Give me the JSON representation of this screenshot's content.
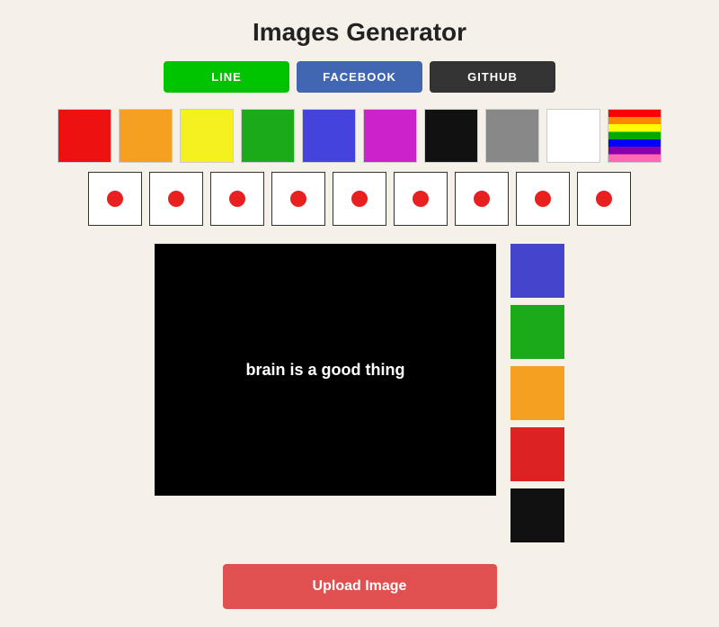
{
  "page": {
    "title": "Images Generator"
  },
  "platform_buttons": [
    {
      "id": "line",
      "label": "LINE",
      "class": "btn-line"
    },
    {
      "id": "facebook",
      "label": "FACEBOOK",
      "class": "btn-facebook"
    },
    {
      "id": "github",
      "label": "GITHUB",
      "class": "btn-github"
    }
  ],
  "color_swatches": [
    {
      "id": "red",
      "color": "#ee1111"
    },
    {
      "id": "orange",
      "color": "#f5a020"
    },
    {
      "id": "yellow",
      "color": "#f5f020"
    },
    {
      "id": "green",
      "color": "#1aaa1a"
    },
    {
      "id": "blue",
      "color": "#4444dd"
    },
    {
      "id": "magenta",
      "color": "#cc22cc"
    },
    {
      "id": "black",
      "color": "#111111"
    },
    {
      "id": "gray",
      "color": "#888888"
    },
    {
      "id": "white",
      "color": "#ffffff"
    },
    {
      "id": "rainbow",
      "color": "rainbow"
    }
  ],
  "dot_swatches_count": 9,
  "canvas": {
    "text": "brain is a good thing",
    "bg_color": "#000000"
  },
  "side_colors": [
    {
      "id": "blue2",
      "color": "#4444cc"
    },
    {
      "id": "green2",
      "color": "#1aaa1a"
    },
    {
      "id": "orange2",
      "color": "#f5a020"
    },
    {
      "id": "red2",
      "color": "#dd2222"
    },
    {
      "id": "black2",
      "color": "#111111"
    }
  ],
  "upload_button": {
    "label": "Upload Image"
  }
}
